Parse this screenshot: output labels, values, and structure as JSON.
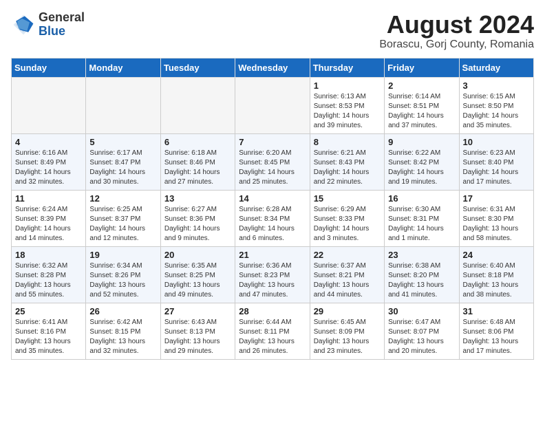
{
  "header": {
    "logo_general": "General",
    "logo_blue": "Blue",
    "month_title": "August 2024",
    "location": "Borascu, Gorj County, Romania"
  },
  "days_of_week": [
    "Sunday",
    "Monday",
    "Tuesday",
    "Wednesday",
    "Thursday",
    "Friday",
    "Saturday"
  ],
  "weeks": [
    [
      {
        "day": "",
        "info": ""
      },
      {
        "day": "",
        "info": ""
      },
      {
        "day": "",
        "info": ""
      },
      {
        "day": "",
        "info": ""
      },
      {
        "day": "1",
        "info": "Sunrise: 6:13 AM\nSunset: 8:53 PM\nDaylight: 14 hours\nand 39 minutes."
      },
      {
        "day": "2",
        "info": "Sunrise: 6:14 AM\nSunset: 8:51 PM\nDaylight: 14 hours\nand 37 minutes."
      },
      {
        "day": "3",
        "info": "Sunrise: 6:15 AM\nSunset: 8:50 PM\nDaylight: 14 hours\nand 35 minutes."
      }
    ],
    [
      {
        "day": "4",
        "info": "Sunrise: 6:16 AM\nSunset: 8:49 PM\nDaylight: 14 hours\nand 32 minutes."
      },
      {
        "day": "5",
        "info": "Sunrise: 6:17 AM\nSunset: 8:47 PM\nDaylight: 14 hours\nand 30 minutes."
      },
      {
        "day": "6",
        "info": "Sunrise: 6:18 AM\nSunset: 8:46 PM\nDaylight: 14 hours\nand 27 minutes."
      },
      {
        "day": "7",
        "info": "Sunrise: 6:20 AM\nSunset: 8:45 PM\nDaylight: 14 hours\nand 25 minutes."
      },
      {
        "day": "8",
        "info": "Sunrise: 6:21 AM\nSunset: 8:43 PM\nDaylight: 14 hours\nand 22 minutes."
      },
      {
        "day": "9",
        "info": "Sunrise: 6:22 AM\nSunset: 8:42 PM\nDaylight: 14 hours\nand 19 minutes."
      },
      {
        "day": "10",
        "info": "Sunrise: 6:23 AM\nSunset: 8:40 PM\nDaylight: 14 hours\nand 17 minutes."
      }
    ],
    [
      {
        "day": "11",
        "info": "Sunrise: 6:24 AM\nSunset: 8:39 PM\nDaylight: 14 hours\nand 14 minutes."
      },
      {
        "day": "12",
        "info": "Sunrise: 6:25 AM\nSunset: 8:37 PM\nDaylight: 14 hours\nand 12 minutes."
      },
      {
        "day": "13",
        "info": "Sunrise: 6:27 AM\nSunset: 8:36 PM\nDaylight: 14 hours\nand 9 minutes."
      },
      {
        "day": "14",
        "info": "Sunrise: 6:28 AM\nSunset: 8:34 PM\nDaylight: 14 hours\nand 6 minutes."
      },
      {
        "day": "15",
        "info": "Sunrise: 6:29 AM\nSunset: 8:33 PM\nDaylight: 14 hours\nand 3 minutes."
      },
      {
        "day": "16",
        "info": "Sunrise: 6:30 AM\nSunset: 8:31 PM\nDaylight: 14 hours\nand 1 minute."
      },
      {
        "day": "17",
        "info": "Sunrise: 6:31 AM\nSunset: 8:30 PM\nDaylight: 13 hours\nand 58 minutes."
      }
    ],
    [
      {
        "day": "18",
        "info": "Sunrise: 6:32 AM\nSunset: 8:28 PM\nDaylight: 13 hours\nand 55 minutes."
      },
      {
        "day": "19",
        "info": "Sunrise: 6:34 AM\nSunset: 8:26 PM\nDaylight: 13 hours\nand 52 minutes."
      },
      {
        "day": "20",
        "info": "Sunrise: 6:35 AM\nSunset: 8:25 PM\nDaylight: 13 hours\nand 49 minutes."
      },
      {
        "day": "21",
        "info": "Sunrise: 6:36 AM\nSunset: 8:23 PM\nDaylight: 13 hours\nand 47 minutes."
      },
      {
        "day": "22",
        "info": "Sunrise: 6:37 AM\nSunset: 8:21 PM\nDaylight: 13 hours\nand 44 minutes."
      },
      {
        "day": "23",
        "info": "Sunrise: 6:38 AM\nSunset: 8:20 PM\nDaylight: 13 hours\nand 41 minutes."
      },
      {
        "day": "24",
        "info": "Sunrise: 6:40 AM\nSunset: 8:18 PM\nDaylight: 13 hours\nand 38 minutes."
      }
    ],
    [
      {
        "day": "25",
        "info": "Sunrise: 6:41 AM\nSunset: 8:16 PM\nDaylight: 13 hours\nand 35 minutes."
      },
      {
        "day": "26",
        "info": "Sunrise: 6:42 AM\nSunset: 8:15 PM\nDaylight: 13 hours\nand 32 minutes."
      },
      {
        "day": "27",
        "info": "Sunrise: 6:43 AM\nSunset: 8:13 PM\nDaylight: 13 hours\nand 29 minutes."
      },
      {
        "day": "28",
        "info": "Sunrise: 6:44 AM\nSunset: 8:11 PM\nDaylight: 13 hours\nand 26 minutes."
      },
      {
        "day": "29",
        "info": "Sunrise: 6:45 AM\nSunset: 8:09 PM\nDaylight: 13 hours\nand 23 minutes."
      },
      {
        "day": "30",
        "info": "Sunrise: 6:47 AM\nSunset: 8:07 PM\nDaylight: 13 hours\nand 20 minutes."
      },
      {
        "day": "31",
        "info": "Sunrise: 6:48 AM\nSunset: 8:06 PM\nDaylight: 13 hours\nand 17 minutes."
      }
    ]
  ]
}
